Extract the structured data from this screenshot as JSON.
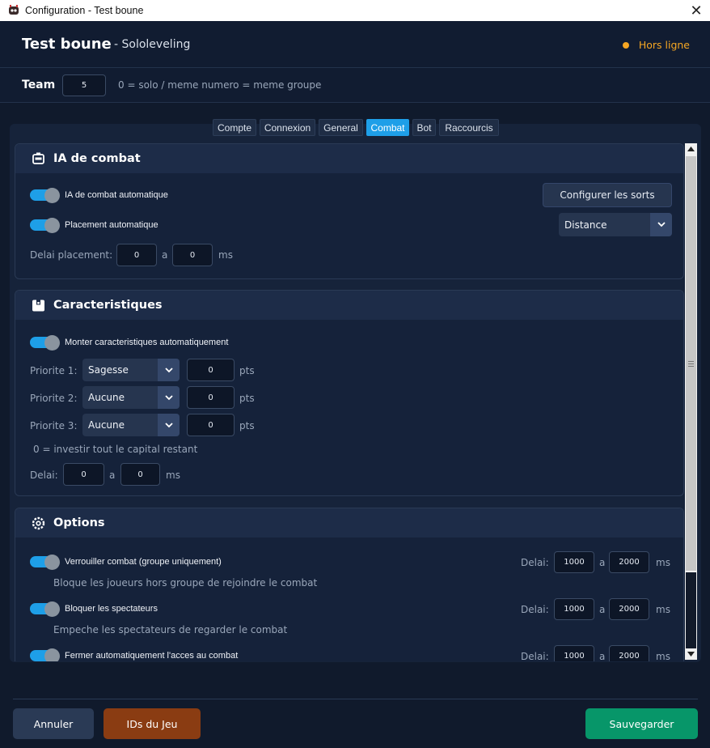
{
  "window": {
    "title": "Configuration - Test boune"
  },
  "header": {
    "account": "Test boune",
    "server": "- Sololeveling",
    "status": "Hors ligne",
    "status_color": "#f5a623"
  },
  "team": {
    "label": "Team",
    "value": "5",
    "hint": "0 = solo  /  meme numero = meme groupe"
  },
  "tabs": [
    {
      "label": "Compte",
      "active": false
    },
    {
      "label": "Connexion",
      "active": false
    },
    {
      "label": "General",
      "active": false
    },
    {
      "label": "Combat",
      "active": true
    },
    {
      "label": "Bot",
      "active": false
    },
    {
      "label": "Raccourcis",
      "active": false
    }
  ],
  "ia": {
    "title": "IA de combat",
    "toggle1": "IA de combat automatique",
    "toggle2": "Placement automatique",
    "configure_btn": "Configurer les sorts",
    "placement_select": "Distance",
    "delay_label": "Delai placement:",
    "delay_min": "0",
    "a": "a",
    "delay_max": "0",
    "unit": "ms"
  },
  "carac": {
    "title": "Caracteristiques",
    "toggle": "Monter caracteristiques automatiquement",
    "prio": [
      {
        "label": "Priorite 1:",
        "stat": "Sagesse",
        "pts": "0"
      },
      {
        "label": "Priorite 2:",
        "stat": "Aucune",
        "pts": "0"
      },
      {
        "label": "Priorite 3:",
        "stat": "Aucune",
        "pts": "0"
      }
    ],
    "pts_unit": "pts",
    "note": "0 = investir tout le capital restant",
    "delay_label": "Delai:",
    "delay_min": "0",
    "a": "a",
    "delay_max": "0",
    "unit": "ms"
  },
  "options": {
    "title": "Options",
    "items": [
      {
        "label": "Verrouiller combat (groupe uniquement)",
        "desc": "Bloque les joueurs hors groupe de rejoindre le combat",
        "delay_label": "Delai:",
        "min": "1000",
        "a": "a",
        "max": "2000",
        "unit": "ms"
      },
      {
        "label": "Bloquer les spectateurs",
        "desc": "Empeche les spectateurs de regarder le combat",
        "delay_label": "Delai:",
        "min": "1000",
        "a": "a",
        "max": "2000",
        "unit": "ms"
      },
      {
        "label": "Fermer automatiquement l'acces au combat",
        "desc": "",
        "delay_label": "Delai:",
        "min": "1000",
        "a": "a",
        "max": "2000",
        "unit": "ms"
      }
    ]
  },
  "footer": {
    "cancel": "Annuler",
    "ids": "IDs du Jeu",
    "save": "Sauvegarder"
  },
  "colors": {
    "accent": "#1e9fe8",
    "ids_button": "#8a3c12",
    "save_button": "#079669",
    "cancel_button": "#2a3a55"
  }
}
